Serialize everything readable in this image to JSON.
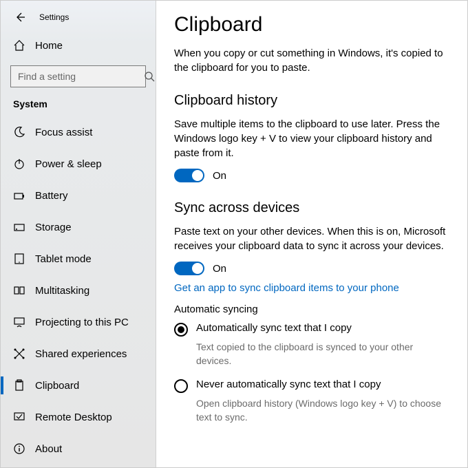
{
  "header": {
    "app_title": "Settings"
  },
  "sidebar": {
    "home_label": "Home",
    "search_placeholder": "Find a setting",
    "category_label": "System",
    "items": [
      {
        "label": "Focus assist"
      },
      {
        "label": "Power & sleep"
      },
      {
        "label": "Battery"
      },
      {
        "label": "Storage"
      },
      {
        "label": "Tablet mode"
      },
      {
        "label": "Multitasking"
      },
      {
        "label": "Projecting to this PC"
      },
      {
        "label": "Shared experiences"
      },
      {
        "label": "Clipboard"
      },
      {
        "label": "Remote Desktop"
      },
      {
        "label": "About"
      }
    ]
  },
  "main": {
    "title": "Clipboard",
    "intro": "When you copy or cut something in Windows, it's copied to the clipboard for you to paste.",
    "history": {
      "heading": "Clipboard history",
      "desc": "Save multiple items to the clipboard to use later. Press the Windows logo key + V to view your clipboard history and paste from it.",
      "toggle_state": "On"
    },
    "sync": {
      "heading": "Sync across devices",
      "desc": "Paste text on your other devices. When this is on, Microsoft receives your clipboard data to sync it across your devices.",
      "toggle_state": "On",
      "link": "Get an app to sync clipboard items to your phone",
      "auto_heading": "Automatic syncing",
      "options": [
        {
          "label": "Automatically sync text that I copy",
          "desc": "Text copied to the clipboard is synced to your other devices.",
          "checked": true
        },
        {
          "label": "Never automatically sync text that I copy",
          "desc": "Open clipboard history (Windows logo key + V) to choose text to sync.",
          "checked": false
        }
      ]
    }
  }
}
